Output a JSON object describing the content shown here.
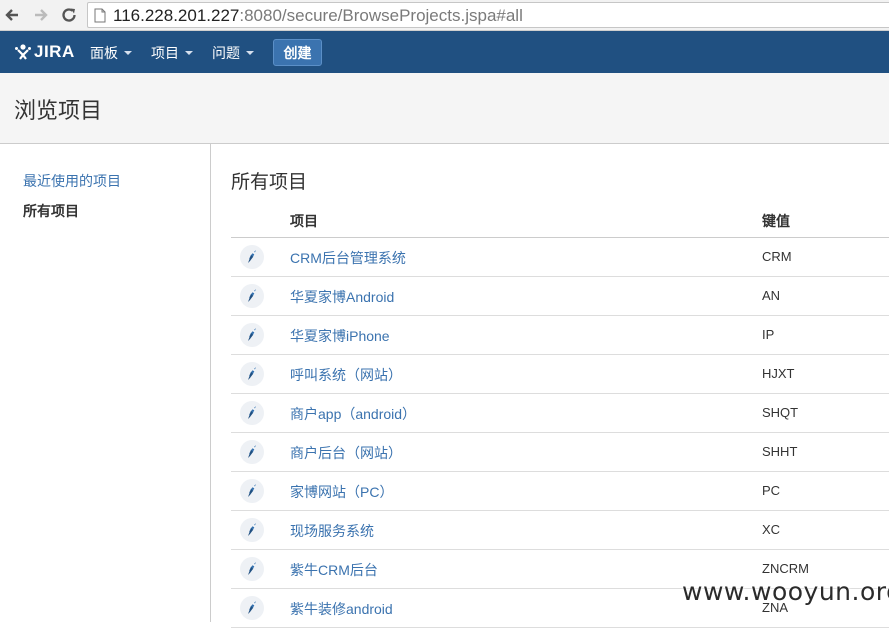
{
  "browser": {
    "url_host": "116.228.201.227",
    "url_rest": ":8080/secure/BrowseProjects.jspa#all"
  },
  "header": {
    "logo": "JIRA",
    "menu": [
      {
        "label": "面板"
      },
      {
        "label": "项目"
      },
      {
        "label": "问题"
      }
    ],
    "create_label": "创建"
  },
  "page": {
    "title": "浏览项目"
  },
  "sidebar": {
    "items": [
      {
        "label": "最近使用的项目",
        "active": false
      },
      {
        "label": "所有项目",
        "active": true
      }
    ]
  },
  "main": {
    "section_title": "所有项目",
    "columns": {
      "name": "项目",
      "key": "键值"
    },
    "projects": [
      {
        "name": "CRM后台管理系统",
        "key": "CRM"
      },
      {
        "name": "华夏家博Android",
        "key": "AN"
      },
      {
        "name": "华夏家博iPhone",
        "key": "IP"
      },
      {
        "name": "呼叫系统（网站）",
        "key": "HJXT"
      },
      {
        "name": "商户app（android）",
        "key": "SHQT"
      },
      {
        "name": "商户后台（网站）",
        "key": "SHHT"
      },
      {
        "name": "家博网站（PC）",
        "key": "PC"
      },
      {
        "name": "现场服务系统",
        "key": "XC"
      },
      {
        "name": "紫牛CRM后台",
        "key": "ZNCRM"
      },
      {
        "name": "紫牛装修android",
        "key": "ZNA"
      }
    ]
  },
  "watermark": "www.wooyun.org"
}
